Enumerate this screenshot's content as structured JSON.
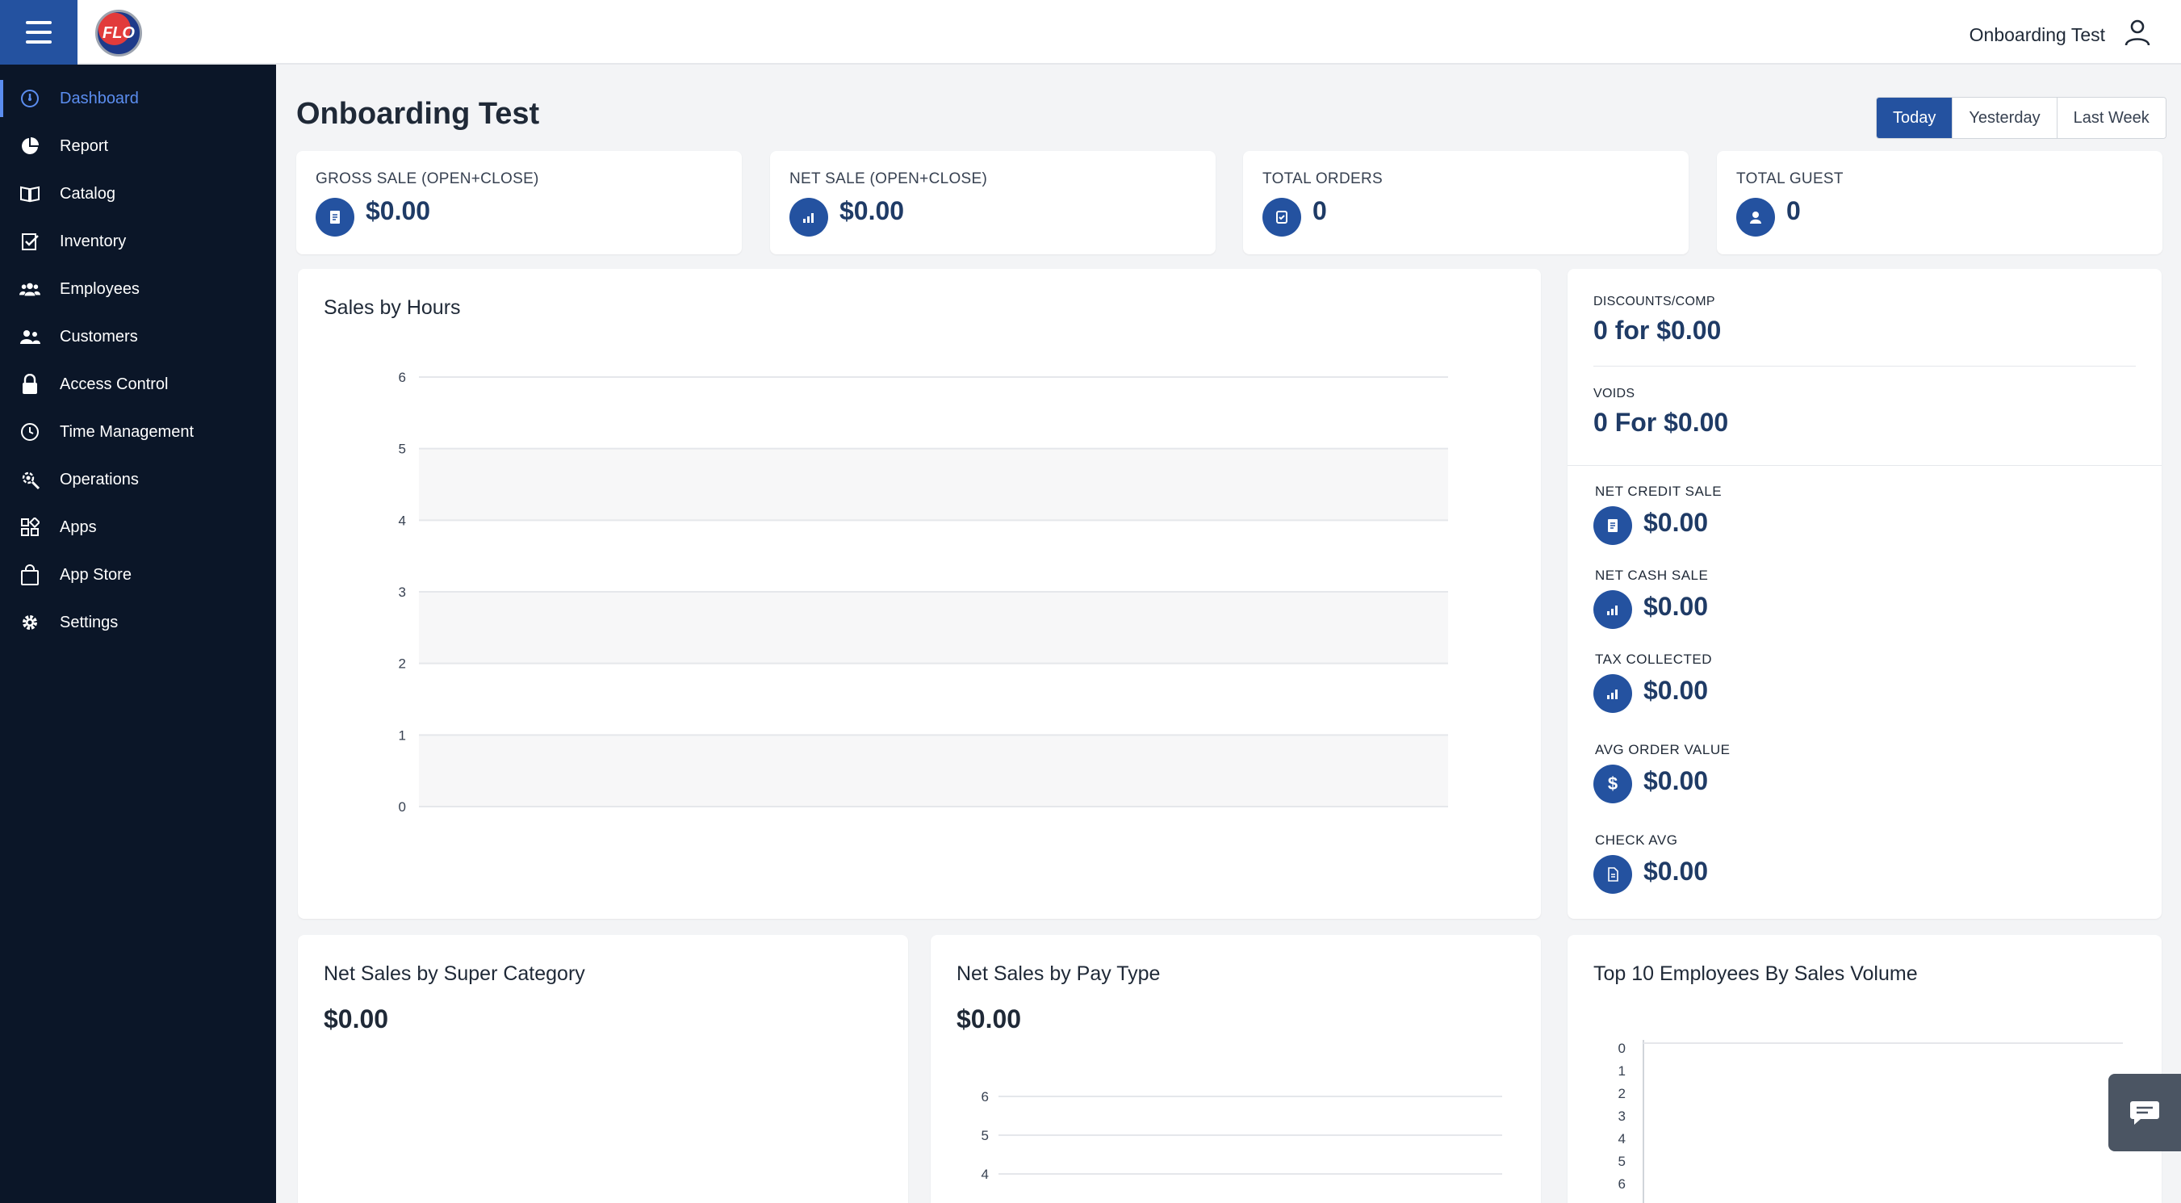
{
  "header": {
    "logo_text": "FLO",
    "user_name": "Onboarding Test"
  },
  "sidebar": {
    "items": [
      {
        "label": "Dashboard",
        "icon": "dashboard-icon",
        "active": true
      },
      {
        "label": "Report",
        "icon": "pie-chart-icon"
      },
      {
        "label": "Catalog",
        "icon": "book-icon"
      },
      {
        "label": "Inventory",
        "icon": "clipboard-check-icon"
      },
      {
        "label": "Employees",
        "icon": "users-icon"
      },
      {
        "label": "Customers",
        "icon": "customers-icon"
      },
      {
        "label": "Access Control",
        "icon": "lock-icon"
      },
      {
        "label": "Time Management",
        "icon": "clock-icon"
      },
      {
        "label": "Operations",
        "icon": "operations-gear-icon"
      },
      {
        "label": "Apps",
        "icon": "apps-grid-icon"
      },
      {
        "label": "App Store",
        "icon": "shopping-bag-icon"
      },
      {
        "label": "Settings",
        "icon": "gear-icon"
      }
    ]
  },
  "page": {
    "title": "Onboarding Test"
  },
  "date_tabs": {
    "today": "Today",
    "yesterday": "Yesterday",
    "last_week": "Last Week",
    "selected": "Today"
  },
  "stats": {
    "gross_sale": {
      "label": "GROSS SALE (OPEN+CLOSE)",
      "value": "$0.00"
    },
    "net_sale": {
      "label": "NET SALE (OPEN+CLOSE)",
      "value": "$0.00"
    },
    "total_orders": {
      "label": "TOTAL ORDERS",
      "value": "0"
    },
    "total_guest": {
      "label": "TOTAL GUEST",
      "value": "0"
    }
  },
  "summary": {
    "discounts_label": "DISCOUNTS/COMP",
    "discounts_value": "0 for $0.00",
    "voids_label": "VOIDS",
    "voids_value": "0 For $0.00",
    "net_credit_label": "NET CREDIT SALE",
    "net_credit_value": "$0.00",
    "net_cash_label": "NET CASH SALE",
    "net_cash_value": "$0.00",
    "tax_label": "TAX COLLECTED",
    "tax_value": "$0.00",
    "avg_order_label": "AVG ORDER VALUE",
    "avg_order_value": "$0.00",
    "avg_order_symbol": "$",
    "check_avg_label": "CHECK AVG",
    "check_avg_value": "$0.00"
  },
  "panels": {
    "super_category_title": "Net Sales by Super Category",
    "super_category_value": "$0.00",
    "pay_type_title": "Net Sales by Pay Type",
    "pay_type_value": "$0.00",
    "top_employees_title": "Top 10 Employees By Sales Volume"
  },
  "colors": {
    "primary": "#2452a0",
    "sidebar_bg": "#0b1628",
    "active_nav": "#5b8def"
  },
  "chart_data": [
    {
      "type": "bar",
      "title": "Sales by Hours",
      "yticks": [
        0,
        1,
        2,
        3,
        4,
        5,
        6
      ],
      "ylim": [
        0,
        6
      ],
      "categories": [],
      "values": [],
      "grid": true,
      "banded": true
    },
    {
      "type": "bar",
      "title": "Net Sales by Pay Type",
      "yticks": [
        4,
        5,
        6
      ],
      "ylim": [
        0,
        6
      ],
      "categories": [],
      "values": [],
      "grid": true
    },
    {
      "type": "bar",
      "title": "Top 10 Employees By Sales Volume",
      "orientation": "horizontal",
      "yticks": [
        0,
        1,
        2,
        3,
        4,
        5,
        6
      ],
      "categories": [],
      "values": []
    }
  ]
}
